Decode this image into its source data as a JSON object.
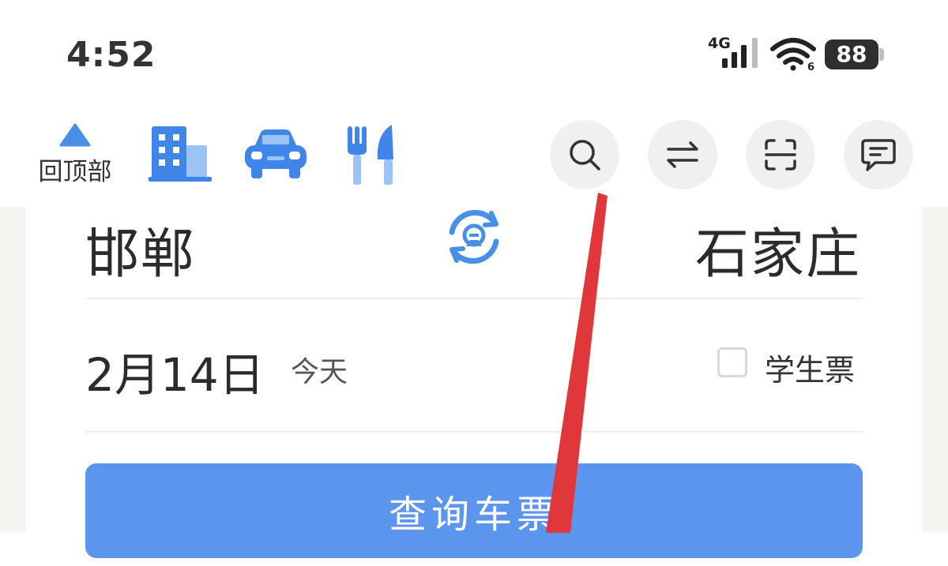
{
  "status_bar": {
    "time": "4:52",
    "network": "4G",
    "battery": "88"
  },
  "toolbar": {
    "back_to_top_label": "回顶部",
    "quick_icons": [
      "hotel-icon",
      "car-icon",
      "dining-icon"
    ],
    "round_buttons": [
      "search-icon",
      "swap-icon",
      "scan-icon",
      "message-icon"
    ]
  },
  "ticket_form": {
    "from_station": "邯郸",
    "to_station": "石家庄",
    "date": "2月14日",
    "day_label": "今天",
    "student_ticket_label": "学生票",
    "student_ticket_checked": false,
    "query_button_label": "查询车票"
  },
  "colors": {
    "accent": "#4a8fe7",
    "query_button": "#5b95ee",
    "annotation": "#e0383a"
  }
}
